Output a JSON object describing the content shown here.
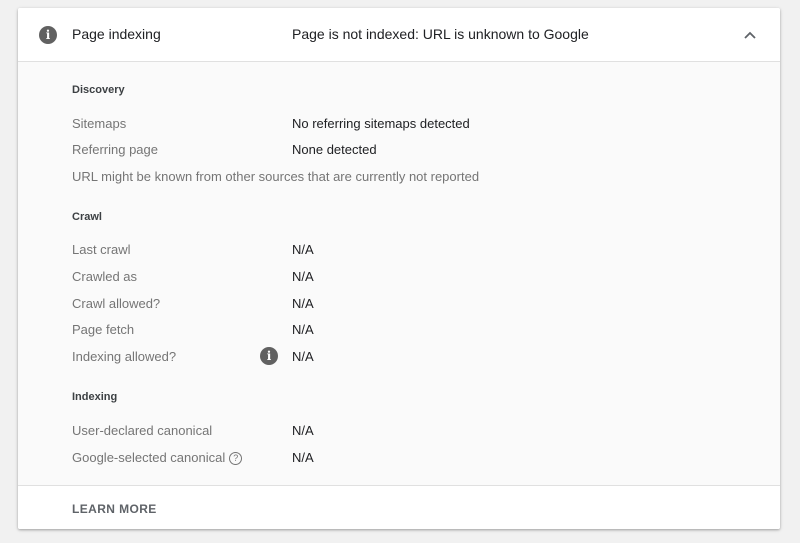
{
  "header": {
    "icon": "info-icon",
    "title": "Page indexing",
    "status": "Page is not indexed: URL is unknown to Google",
    "toggle_icon": "chevron-up-icon"
  },
  "discovery": {
    "title": "Discovery",
    "rows": [
      {
        "label": "Sitemaps",
        "value": "No referring sitemaps detected"
      },
      {
        "label": "Referring page",
        "value": "None detected"
      }
    ],
    "note": "URL might be known from other sources that are currently not reported"
  },
  "crawl": {
    "title": "Crawl",
    "rows": [
      {
        "label": "Last crawl",
        "value": "N/A"
      },
      {
        "label": "Crawled as",
        "value": "N/A"
      },
      {
        "label": "Crawl allowed?",
        "value": "N/A"
      },
      {
        "label": "Page fetch",
        "value": "N/A"
      },
      {
        "label": "Indexing allowed?",
        "value": "N/A"
      }
    ]
  },
  "indexing": {
    "title": "Indexing",
    "rows": [
      {
        "label": "User-declared canonical",
        "value": "N/A"
      },
      {
        "label": "Google-selected canonical",
        "value": "N/A"
      }
    ]
  },
  "footer": {
    "learn_more": "LEARN MORE"
  },
  "colors": {
    "card_background": "#fafafa",
    "header_background": "#ffffff",
    "icon": "#616161",
    "label": "#757575",
    "value": "#202124"
  }
}
